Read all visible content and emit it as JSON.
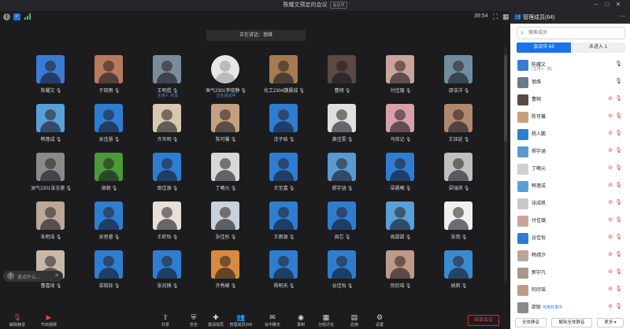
{
  "window": {
    "title": "陈耀文预定的会议",
    "badge": "会议中",
    "controls": [
      "minimize-icon",
      "maximize-icon",
      "close-icon"
    ]
  },
  "status": {
    "timer": "39:54",
    "speaking_label": "正在讲话：",
    "speaking_name": "翁维"
  },
  "participants": [
    {
      "name": "陈耀文",
      "tag": "",
      "color": "#3a7bd5"
    },
    {
      "name": "于晓雨",
      "tag": "",
      "color": "#b87a5e"
    },
    {
      "name": "王明煜",
      "tag": "主持人·共享",
      "color": "#7a8b9a"
    },
    {
      "name": "渔气2301李晓静",
      "tag": "正在讲话中",
      "color": "#e8e8e8",
      "round": true
    },
    {
      "name": "化工2304魏晨成",
      "tag": "",
      "color": "#a67a52"
    },
    {
      "name": "曹翔",
      "tag": "",
      "color": "#5a4a42"
    },
    {
      "name": "付佳璐",
      "tag": "",
      "color": "#c9a49a"
    },
    {
      "name": "邵浩洋",
      "tag": "",
      "color": "#6f8fa0"
    },
    {
      "name": "韩蓬成",
      "tag": "",
      "color": "#5aa0d8"
    },
    {
      "name": "吴佳慧",
      "tag": "",
      "color": "#2f7dd0"
    },
    {
      "name": "许天明",
      "tag": "",
      "color": "#d7c8b0"
    },
    {
      "name": "陈可馨",
      "tag": "",
      "color": "#c5a080"
    },
    {
      "name": "沈子晗",
      "tag": "",
      "color": "#2f7dd0"
    },
    {
      "name": "黄佳雯",
      "tag": "",
      "color": "#e0e0e0"
    },
    {
      "name": "马依记",
      "tag": "",
      "color": "#d8a0a8"
    },
    {
      "name": "王钰廷",
      "tag": "",
      "color": "#b08870"
    },
    {
      "name": "油气2301张志豪",
      "tag": "",
      "color": "#8a8a8a"
    },
    {
      "name": "谢朝",
      "tag": "",
      "color": "#4a9a3a"
    },
    {
      "name": "田佳源",
      "tag": "",
      "color": "#2f7dd0"
    },
    {
      "name": "丁曦元",
      "tag": "",
      "color": "#d8d8d8"
    },
    {
      "name": "王至嘉",
      "tag": "",
      "color": "#2f7dd0"
    },
    {
      "name": "郝宇涵",
      "tag": "",
      "color": "#5a9ad0"
    },
    {
      "name": "梁晨曦",
      "tag": "",
      "color": "#2f7dd0"
    },
    {
      "name": "梁瑞琪",
      "tag": "",
      "color": "#c0c0c0"
    },
    {
      "name": "朱明浩",
      "tag": "",
      "color": "#bca898"
    },
    {
      "name": "吴思睿",
      "tag": "",
      "color": "#2f7dd0"
    },
    {
      "name": "王昕怡",
      "tag": "",
      "color": "#e8e0d8"
    },
    {
      "name": "张佳彤",
      "tag": "",
      "color": "#c8d0d8"
    },
    {
      "name": "王雨源",
      "tag": "",
      "color": "#2f7dd0"
    },
    {
      "name": "周芯",
      "tag": "",
      "color": "#2f7dd0"
    },
    {
      "name": "周甜甜",
      "tag": "",
      "color": "#5aa0d8"
    },
    {
      "name": "张莞",
      "tag": "",
      "color": "#f0f0f0"
    },
    {
      "name": "曹嘉琦",
      "tag": "",
      "color": "#c8b8a8"
    },
    {
      "name": "梁晓钰",
      "tag": "",
      "color": "#2f7dd0"
    },
    {
      "name": "张兆楠",
      "tag": "",
      "color": "#2f7dd0"
    },
    {
      "name": "许秀峰",
      "tag": "",
      "color": "#d88a40"
    },
    {
      "name": "杨明天",
      "tag": "",
      "color": "#2f7dd0"
    },
    {
      "name": "谷佳怡",
      "tag": "",
      "color": "#2f7dd0"
    },
    {
      "name": "倪欣瑶",
      "tag": "",
      "color": "#c09a88"
    },
    {
      "name": "姚莉",
      "tag": "",
      "color": "#3a8ad0"
    }
  ],
  "grid_tags": {
    "row5_col1": "可用共享中"
  },
  "panel": {
    "title": "管理成员(64)",
    "search_placeholder": "搜索成员",
    "tab_in": "会议中 63",
    "tab_out": "未进入 1",
    "members": [
      {
        "name": "陈耀文",
        "role": "(主持人, 我)",
        "tag": "",
        "muted": false,
        "color": "#3a7bd5"
      },
      {
        "name": "翁维",
        "role": "",
        "tag": "",
        "muted": false,
        "color": "#6a7a88"
      },
      {
        "name": "曹翔",
        "role": "",
        "tag": "",
        "muted": true,
        "color": "#5a4a42"
      },
      {
        "name": "陈可馨",
        "role": "",
        "tag": "",
        "muted": true,
        "color": "#c5a080"
      },
      {
        "name": "杨人鹏",
        "role": "",
        "tag": "",
        "muted": true,
        "color": "#2f7dd0"
      },
      {
        "name": "郝宇涵",
        "role": "",
        "tag": "",
        "muted": true,
        "color": "#5a9ad0"
      },
      {
        "name": "丁曦元",
        "role": "",
        "tag": "",
        "muted": true,
        "color": "#d0d0d0"
      },
      {
        "name": "韩蓬成",
        "role": "",
        "tag": "",
        "muted": true,
        "color": "#5aa0d8"
      },
      {
        "name": "张成帆",
        "role": "",
        "tag": "",
        "muted": true,
        "color": "#c8c8c8"
      },
      {
        "name": "付佳璐",
        "role": "",
        "tag": "",
        "muted": true,
        "color": "#c9a49a"
      },
      {
        "name": "谷佳怡",
        "role": "",
        "tag": "",
        "muted": true,
        "color": "#2f7dd0"
      },
      {
        "name": "韩靖汐",
        "role": "",
        "tag": "",
        "muted": true,
        "color": "#b8a898"
      },
      {
        "name": "郭宇凡",
        "role": "",
        "tag": "",
        "muted": true,
        "color": "#a89888"
      },
      {
        "name": "阿欣瑶",
        "role": "",
        "tag": "",
        "muted": true,
        "color": "#c09a88"
      },
      {
        "name": "邵耿",
        "role": "",
        "tag": "可用共享中",
        "muted": true,
        "color": "#8a8a8a"
      }
    ],
    "btn_mute_all": "全体静音",
    "btn_unmute_all": "解除全体静音",
    "btn_more": "更多 ▾"
  },
  "chat": {
    "hint": "说点什么..."
  },
  "toolbar": {
    "items": [
      {
        "icon": "mic-icon",
        "label": "解除静音"
      },
      {
        "icon": "camera-icon",
        "label": "开启视频"
      },
      {
        "icon": "share-icon",
        "label": "共享"
      },
      {
        "icon": "security-icon",
        "label": "安全"
      },
      {
        "icon": "invite-icon",
        "label": "邀请成员"
      },
      {
        "icon": "members-icon",
        "label": "管理成员(64)"
      },
      {
        "icon": "chat-icon",
        "label": "会中聊天"
      },
      {
        "icon": "record-icon",
        "label": "录制"
      },
      {
        "icon": "whiteboard-icon",
        "label": "分组讨论"
      },
      {
        "icon": "apps-icon",
        "label": "应用"
      },
      {
        "icon": "settings-icon",
        "label": "设置"
      }
    ],
    "end_label": "结束会议"
  }
}
